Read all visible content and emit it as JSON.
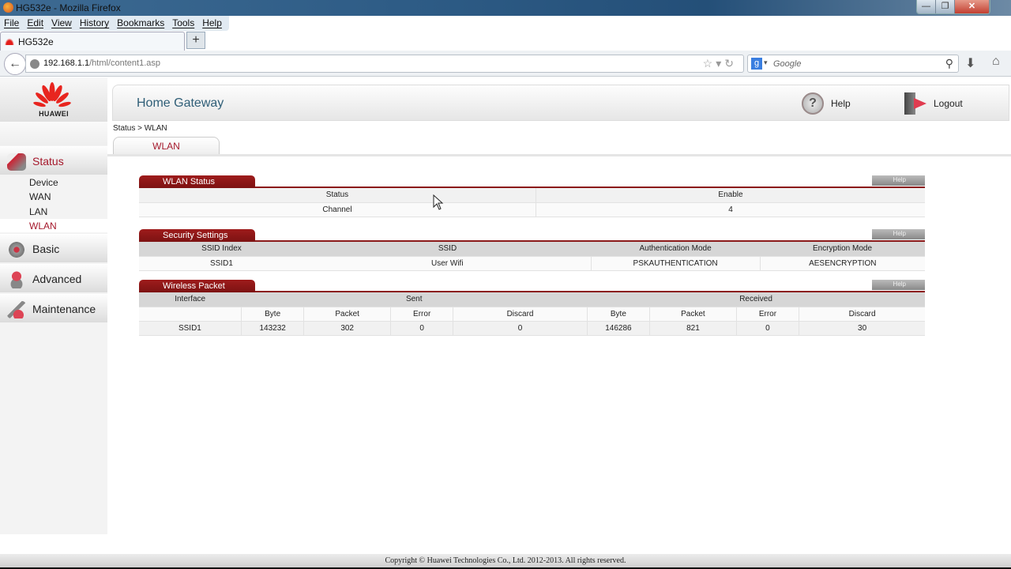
{
  "browser": {
    "window_title": "HG532e - Mozilla Firefox",
    "menu": [
      "File",
      "Edit",
      "View",
      "History",
      "Bookmarks",
      "Tools",
      "Help"
    ],
    "tab_title": "HG532e",
    "new_tab_label": "+",
    "url_host": "192.168.1.1",
    "url_path": "/html/content1.asp",
    "search_placeholder": "Google",
    "window_controls": {
      "minimize": "—",
      "maximize": "❐",
      "close": "✕"
    }
  },
  "brand": {
    "logo_text": "HUAWEI",
    "accent": "#a5182b",
    "tab_red": "#8b1a1a"
  },
  "header": {
    "title": "Home Gateway",
    "help_label": "Help",
    "logout_label": "Logout"
  },
  "breadcrumb": "Status > WLAN",
  "subtab": "WLAN",
  "sidebar": {
    "sections": [
      {
        "label": "Status",
        "active": true,
        "items": [
          "Device",
          "WAN",
          "LAN",
          "WLAN"
        ],
        "active_item": "WLAN"
      },
      {
        "label": "Basic"
      },
      {
        "label": "Advanced"
      },
      {
        "label": "Maintenance"
      }
    ]
  },
  "wlan_status": {
    "title": "WLAN Status",
    "help": "Help",
    "rows": [
      {
        "label": "Status",
        "value": "Enable"
      },
      {
        "label": "Channel",
        "value": "4"
      }
    ]
  },
  "security": {
    "title": "Security Settings",
    "help": "Help",
    "headers": [
      "SSID Index",
      "SSID",
      "Authentication Mode",
      "Encryption Mode"
    ],
    "rows": [
      [
        "SSID1",
        "User Wifi",
        "PSKAUTHENTICATION",
        "AESENCRYPTION"
      ]
    ]
  },
  "wireless_packet": {
    "title": "Wireless Packet",
    "help": "Help",
    "group_headers": {
      "interface": "Interface",
      "sent": "Sent",
      "received": "Received"
    },
    "sub_headers": [
      "Byte",
      "Packet",
      "Error",
      "Discard",
      "Byte",
      "Packet",
      "Error",
      "Discard"
    ],
    "rows": [
      [
        "SSID1",
        "143232",
        "302",
        "0",
        "0",
        "146286",
        "821",
        "0",
        "30"
      ]
    ]
  },
  "footer": "Copyright © Huawei Technologies Co., Ltd. 2012-2013. All rights reserved."
}
